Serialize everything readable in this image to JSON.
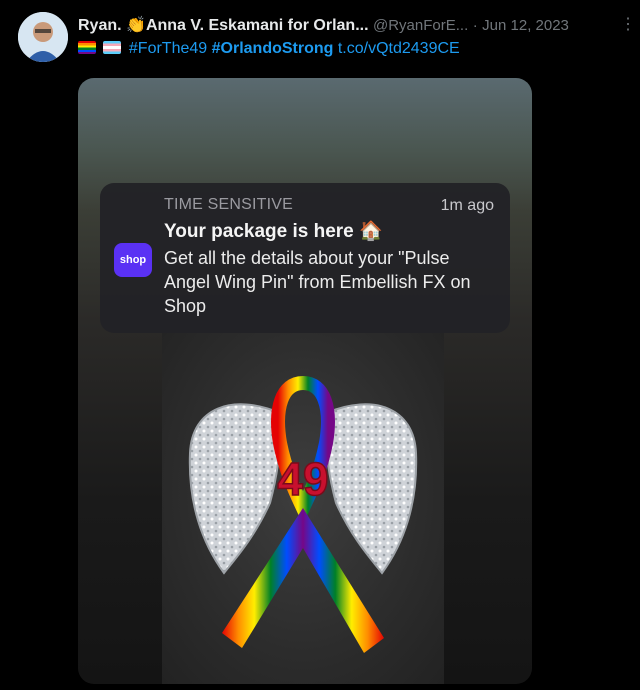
{
  "tweet": {
    "author_name": "Ryan. 👏Anna V. Eskamani for Orlan...",
    "handle": "@RyanForE...",
    "separator": "·",
    "date": "Jun 12, 2023",
    "hashtag_1": "#ForThe49",
    "hashtag_2": "#OrlandoStrong",
    "link": "t.co/vQtd2439CE",
    "more_icon": "more-icon"
  },
  "notification": {
    "label": "TIME SENSITIVE",
    "time": "1m ago",
    "title": "Your package is here 🏠",
    "body": "Get all the details about your \"Pulse Angel Wing Pin\" from Embellish FX on Shop",
    "app_icon_text": "shop",
    "app_icon_color": "#5a31f4"
  },
  "pin": {
    "number": "49"
  }
}
